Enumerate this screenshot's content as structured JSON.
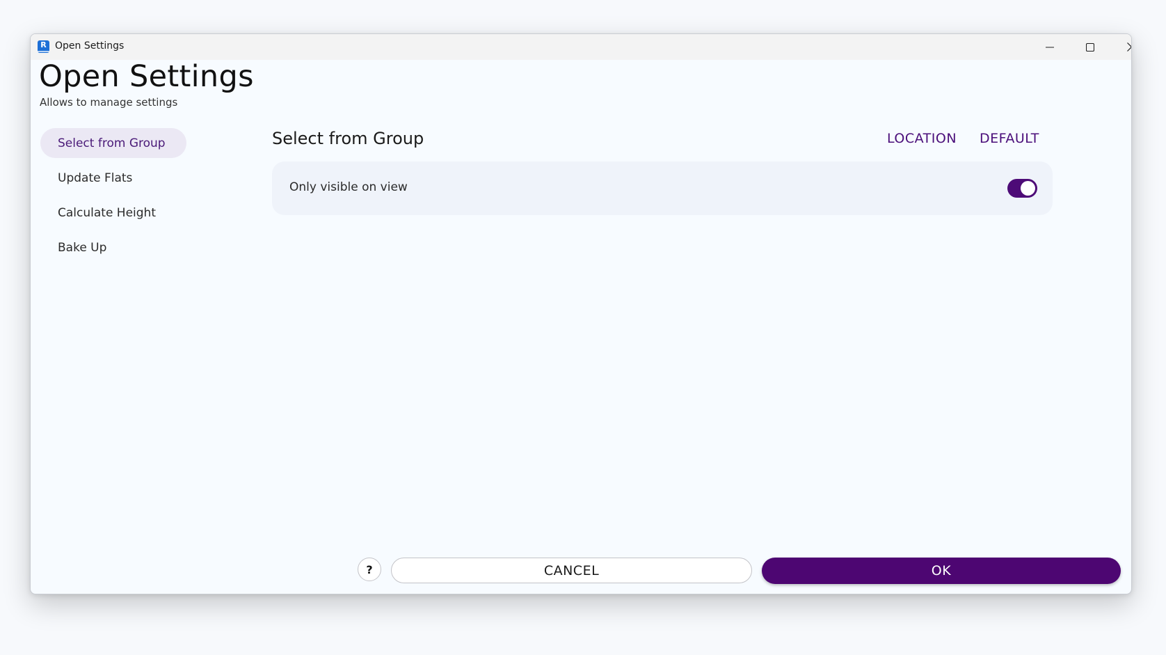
{
  "window": {
    "title": "Open Settings",
    "app_icon_letter": "R"
  },
  "header": {
    "title": "Open Settings",
    "subtitle": "Allows to manage settings"
  },
  "sidebar": {
    "items": [
      {
        "label": "Select from Group",
        "active": true
      },
      {
        "label": "Update Flats",
        "active": false
      },
      {
        "label": "Calculate Height",
        "active": false
      },
      {
        "label": "Bake Up",
        "active": false
      }
    ]
  },
  "main": {
    "section_title": "Select from Group",
    "actions": {
      "location": "LOCATION",
      "default": "DEFAULT"
    },
    "settings": [
      {
        "label": "Only visible on view",
        "enabled": true
      }
    ]
  },
  "footer": {
    "help_label": "?",
    "cancel_label": "CANCEL",
    "ok_label": "OK"
  },
  "colors": {
    "accent": "#4d0672",
    "accent_text": "#4a0e7a",
    "active_item_bg": "#ebe8f4",
    "card_bg": "#eff3fa",
    "window_bg": "#f7fbff"
  },
  "icons": {
    "app": "revit-app-icon",
    "minimize": "minimize-icon",
    "maximize": "maximize-icon",
    "close": "close-icon"
  }
}
